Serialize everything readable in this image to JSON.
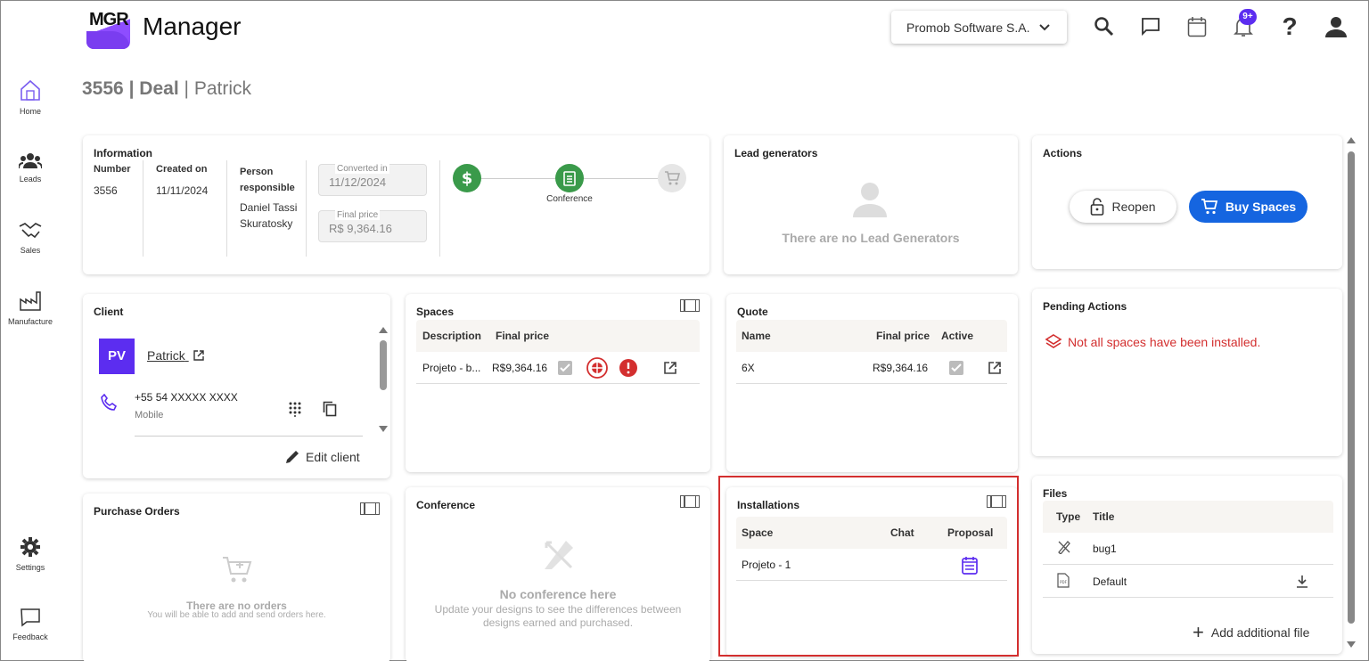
{
  "app": {
    "logo_text": "MGR",
    "title": "Manager"
  },
  "header": {
    "company": "Promob Software S.A.",
    "notifications_badge": "9+"
  },
  "nav": [
    {
      "label": "Home"
    },
    {
      "label": "Leads"
    },
    {
      "label": "Sales"
    },
    {
      "label": "Manufacture"
    },
    {
      "label": "Settings"
    },
    {
      "label": "Feedback"
    }
  ],
  "page": {
    "number": "3556",
    "type": "Deal",
    "client": "Patrick",
    "sep": "|"
  },
  "information": {
    "title": "Information",
    "number_label": "Number",
    "number": "3556",
    "created_label": "Created on",
    "created": "11/11/2024",
    "person_label": "Person responsible",
    "person": "Daniel Tassi Skuratosky",
    "converted_label": "Converted in",
    "converted": "11/12/2024",
    "price_label": "Final price",
    "price": "R$ 9,364.16",
    "step_label": "Conference"
  },
  "lead_generators": {
    "title": "Lead generators",
    "empty": "There are no Lead Generators"
  },
  "actions": {
    "title": "Actions",
    "reopen": "Reopen",
    "buy": "Buy Spaces"
  },
  "client": {
    "title": "Client",
    "initials": "PV",
    "name": "Patrick",
    "phone": "+55 54 XXXXX XXXX",
    "phone_type": "Mobile",
    "edit": "Edit client"
  },
  "spaces": {
    "title": "Spaces",
    "col_desc": "Description",
    "col_price": "Final price",
    "row_desc": "Projeto - b...",
    "row_price": "R$9,364.16"
  },
  "quote": {
    "title": "Quote",
    "col_name": "Name",
    "col_price": "Final price",
    "col_active": "Active",
    "row_name": "6X",
    "row_price": "R$9,364.16"
  },
  "pending": {
    "title": "Pending Actions",
    "message": "Not all spaces have been installed."
  },
  "purchase_orders": {
    "title": "Purchase Orders",
    "empty_title": "There are no orders",
    "empty_sub": "You will be able to add and send orders here."
  },
  "conference": {
    "title": "Conference",
    "empty_title": "No conference here",
    "empty_sub": "Update your designs to see the differences between designs earned and purchased."
  },
  "installations": {
    "title": "Installations",
    "col_space": "Space",
    "col_chat": "Chat",
    "col_proposal": "Proposal",
    "row_space": "Projeto - 1"
  },
  "files": {
    "title": "Files",
    "col_type": "Type",
    "col_title": "Title",
    "rows": [
      "bug1",
      "Default"
    ],
    "add": "Add additional file"
  },
  "colors": {
    "accent": "#1565e0",
    "green": "#3a9a4a",
    "purple": "#5c2df0",
    "alert": "#d32f2f"
  }
}
